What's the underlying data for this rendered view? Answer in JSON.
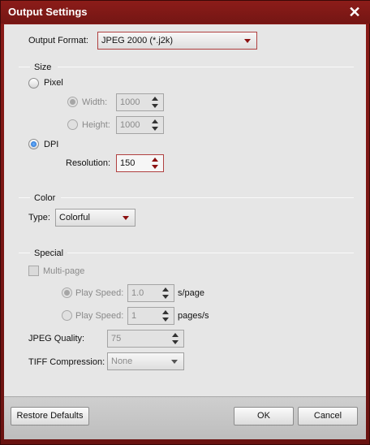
{
  "window": {
    "title": "Output Settings"
  },
  "output_format": {
    "label": "Output Format:",
    "value": "JPEG 2000 (*.j2k)"
  },
  "size": {
    "title": "Size",
    "pixel_label": "Pixel",
    "width_label": "Width:",
    "width_value": "1000",
    "height_label": "Height:",
    "height_value": "1000",
    "dpi_label": "DPI",
    "resolution_label": "Resolution:",
    "resolution_value": "150"
  },
  "color": {
    "title": "Color",
    "type_label": "Type:",
    "type_value": "Colorful"
  },
  "special": {
    "title": "Special",
    "multipage_label": "Multi-page",
    "play_speed_label_1": "Play Speed:",
    "play_speed_value_1": "1.0",
    "play_speed_unit_1": "s/page",
    "play_speed_label_2": "Play Speed:",
    "play_speed_value_2": "1",
    "play_speed_unit_2": "pages/s",
    "jpeg_quality_label": "JPEG Quality:",
    "jpeg_quality_value": "75",
    "tiff_label": "TIFF Compression:",
    "tiff_value": "None"
  },
  "footer": {
    "restore_label": "Restore Defaults",
    "ok_label": "OK",
    "cancel_label": "Cancel"
  },
  "colors": {
    "title_bar": "#7a1816",
    "accent": "#8b1010",
    "radio_selected": "#1b63c7"
  }
}
